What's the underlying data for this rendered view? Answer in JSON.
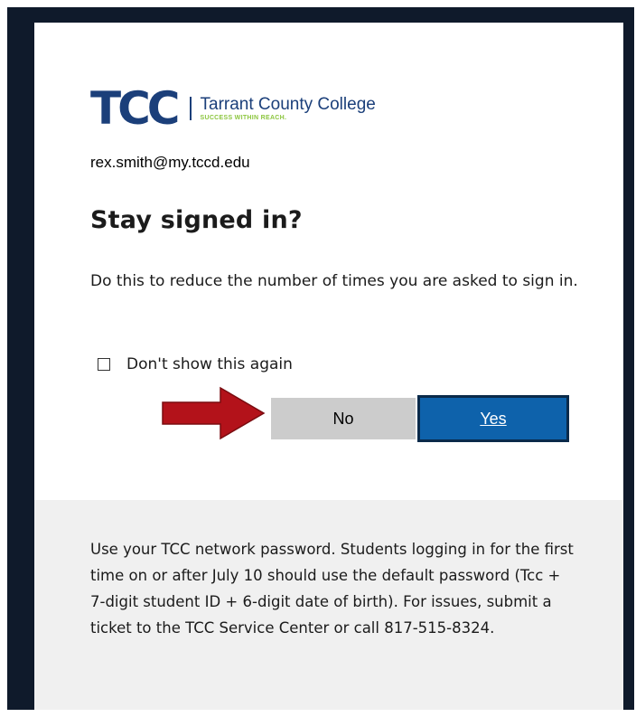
{
  "logo": {
    "mark": "TCC",
    "name": "Tarrant County College",
    "tagline": "SUCCESS WITHIN REACH."
  },
  "account": {
    "email": "rex.smith@my.tccd.edu"
  },
  "dialog": {
    "title": "Stay signed in?",
    "description": "Do this to reduce the number of times you are asked to sign in.",
    "checkbox_label": "Don't show this again",
    "no_label": "No",
    "yes_label": "Yes"
  },
  "footer": {
    "text": "Use your TCC network password. Students logging in for the first time on or after July 10 should use the default password (Tcc + 7-digit student ID + 6-digit date of birth). For issues, submit a ticket to the TCC Service Center or call 817-515-8324."
  },
  "colors": {
    "brand_blue": "#1b3f7a",
    "brand_green": "#8cc63f",
    "primary_button": "#0e62ab",
    "annotation_arrow": "#b3121a"
  },
  "icons": {
    "annotation": "red-arrow-icon"
  }
}
